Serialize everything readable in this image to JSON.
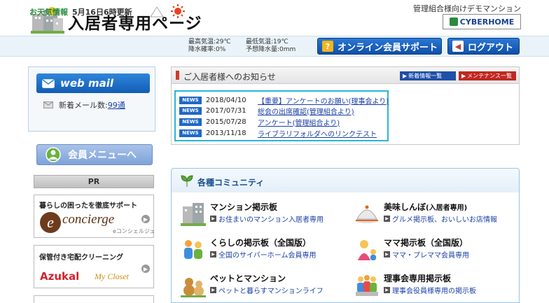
{
  "header": {
    "title": "入居者専用ページ",
    "tagline": "管理組合様向けデモマンション",
    "brand": "CYBERHOME"
  },
  "weather": {
    "label": "お天気情報",
    "date": "5月16日6時更新",
    "high": "最高気温:29℃",
    "rain": "降水確率:0%",
    "low": "最低気温:19℃",
    "forecast_rain": "予想降水量:0mm"
  },
  "buttons": {
    "support": "オンライン会員サポート",
    "logout": "ログアウト"
  },
  "webmail": {
    "title": "web mail",
    "count_label": "新着メール数:",
    "count": "99通"
  },
  "member_menu": "会員メニューへ",
  "pr": {
    "label": "PR",
    "ads": [
      {
        "title": "暮らしの困ったを徹底サポート",
        "brand": "concierge",
        "sub": "eコンシェルジュ"
      },
      {
        "title": "保管付き宅配クリーニング",
        "brand": "Azukal",
        "sub": "My Closet"
      }
    ]
  },
  "news": {
    "title": "ご入居者様へのお知らせ",
    "btn_list": "新着情報一覧",
    "btn_maint": "メンテナンス一覧",
    "badge": "NEWS",
    "items": [
      {
        "date": "2018/04/10",
        "text": "【重要】アンケートのお願い(理事会より)"
      },
      {
        "date": "2017/07/31",
        "text": "総会の出席確認(管理組合より)"
      },
      {
        "date": "2015/07/28",
        "text": "アンケート(管理組合より)"
      },
      {
        "date": "2013/11/18",
        "text": "ライブラリフォルダへのリンクテスト"
      }
    ]
  },
  "community": {
    "title": "各種コミュニティ",
    "items": [
      {
        "title": "マンション掲示板",
        "tag": "",
        "sub": "お住まいのマンション入居者専用"
      },
      {
        "title": "美味しんぼ",
        "tag": "(入居者専用)",
        "sub": "グルメ掲示板、おいしいお店情報"
      },
      {
        "title": "くらしの掲示板（全国版）",
        "tag": "",
        "sub": "全国のサイバーホーム会員専用"
      },
      {
        "title": "ママ掲示板（全国版）",
        "tag": "",
        "sub": "ママ・プレママ会員専用"
      },
      {
        "title": "ペットとマンション",
        "tag": "",
        "sub": "ペットと暮らすマンションライフ"
      },
      {
        "title": "理事会専用掲示板",
        "tag": "",
        "sub": "理事会役員様専用の掲示板"
      }
    ]
  }
}
